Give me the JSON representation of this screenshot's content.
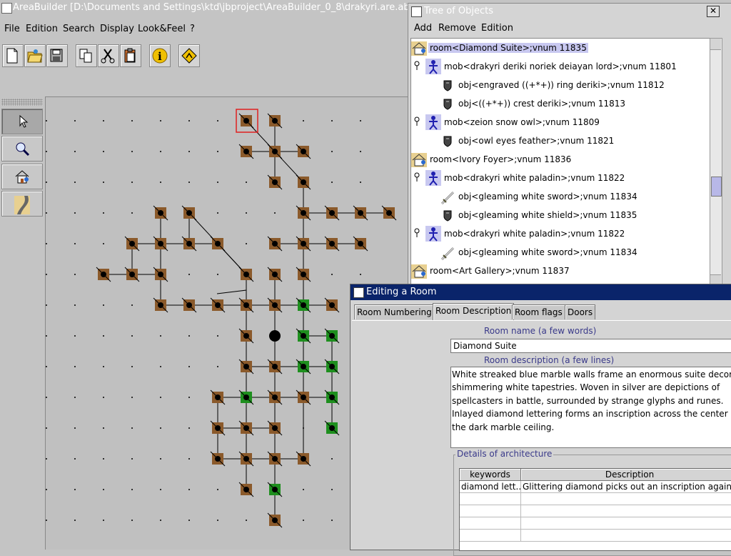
{
  "main_window": {
    "title": "AreaBuilder [D:\\Documents and Settings\\ktd\\jbproject\\AreaBuilder_0_8\\drakyri.are.abp*]",
    "menu": [
      "File",
      "Edition",
      "Search",
      "Display",
      "Look&Feel",
      "?"
    ],
    "toolbar": [
      "new-file-icon",
      "open-folder-icon",
      "save-icon",
      "copy-icon",
      "cut-icon",
      "paste-icon",
      "info-icon",
      "road-sign-icon"
    ],
    "tools": [
      "pointer-icon",
      "zoom-icon",
      "house-icon",
      "road-icon"
    ]
  },
  "map": {
    "colors": {
      "room": "#8b5a2b",
      "special_room": "#1e8f1e",
      "selection": "#e02020"
    },
    "grid_cols": 12,
    "grid_rows": 14
  },
  "tree_window": {
    "title": "Tree of Objects",
    "close_label": "✕",
    "menu": [
      "Add",
      "Remove",
      "Edition"
    ],
    "rows": [
      {
        "kind": "room",
        "label": "room<Diamond Suite>;vnum 11835",
        "selected": true
      },
      {
        "kind": "mob",
        "label": "mob<drakyri deriki noriek deiayan lord>;vnum 11801"
      },
      {
        "kind": "obj",
        "label": "obj<engraved ((+*+)) ring deriki>;vnum 11812"
      },
      {
        "kind": "obj",
        "label": "obj<((+*+)) crest deriki>;vnum 11813"
      },
      {
        "kind": "mob",
        "label": "mob<zeion snow owl>;vnum 11809"
      },
      {
        "kind": "obj",
        "label": "obj<owl eyes feather>;vnum 11821"
      },
      {
        "kind": "room",
        "label": "room<Ivory Foyer>;vnum 11836"
      },
      {
        "kind": "mob",
        "label": "mob<drakyri white paladin>;vnum 11822"
      },
      {
        "kind": "sword",
        "label": "obj<gleaming white sword>;vnum 11834"
      },
      {
        "kind": "obj",
        "label": "obj<gleaming white shield>;vnum 11835"
      },
      {
        "kind": "mob",
        "label": "mob<drakyri white paladin>;vnum 11822"
      },
      {
        "kind": "sword",
        "label": "obj<gleaming white sword>;vnum 11834"
      },
      {
        "kind": "room",
        "label": "room<Art Gallery>;vnum 11837"
      }
    ]
  },
  "edit_window": {
    "title": "Editing a Room",
    "tabs": [
      "Room Numbering",
      "Room Description",
      "Room flags",
      "Doors"
    ],
    "active_tab": "Room Description",
    "room_name_label": "Room name (a few words)",
    "room_name": "Diamond Suite",
    "room_desc_label": "Room description (a few lines)",
    "room_desc_lines": [
      "White streaked blue marble walls frame an enormous suite decorated w",
      "shimmering white tapestries.  Woven in silver are depictions of",
      "spellcasters in battle, surrounded by strange glyphs and runes.",
      "Inlayed diamond lettering forms an inscription across the center of",
      "the dark marble ceiling."
    ],
    "architecture_label": "Details of architecture",
    "table_headers": [
      "keywords",
      "Description"
    ],
    "table_rows": [
      [
        "diamond lett...",
        "Glittering diamond picks out an inscription against the"
      ]
    ]
  }
}
